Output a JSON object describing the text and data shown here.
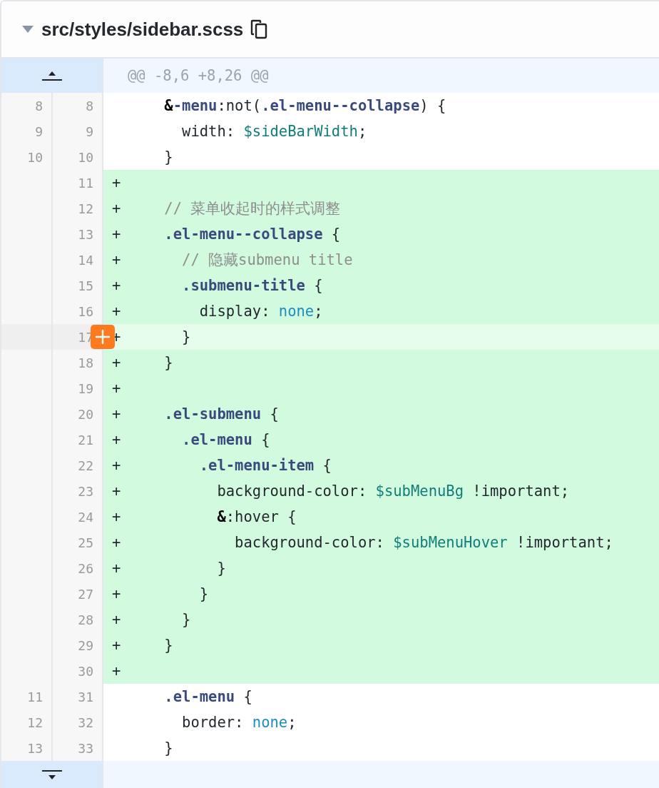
{
  "file_header": {
    "path": "src/styles/sidebar.scss",
    "expanded": true
  },
  "hunk": {
    "text": "@@ -8,6 +8,26 @@"
  },
  "lines": [
    {
      "old": "8",
      "new": "8",
      "kind": "context",
      "hovered": false,
      "tokens": [
        {
          "kind": "amp",
          "text": "    &"
        },
        {
          "kind": "selector",
          "text": "-menu"
        },
        {
          "kind": "plain",
          "text": ":not("
        },
        {
          "kind": "selector",
          "text": ".el-menu--collapse"
        },
        {
          "kind": "plain",
          "text": ") {"
        }
      ]
    },
    {
      "old": "9",
      "new": "9",
      "kind": "context",
      "hovered": false,
      "tokens": [
        {
          "kind": "plain",
          "text": "      width: "
        },
        {
          "kind": "variable",
          "text": "$sideBarWidth"
        },
        {
          "kind": "plain",
          "text": ";"
        }
      ]
    },
    {
      "old": "10",
      "new": "10",
      "kind": "context",
      "hovered": false,
      "tokens": [
        {
          "kind": "plain",
          "text": "    }"
        }
      ]
    },
    {
      "new": "11",
      "kind": "added",
      "marker": "+",
      "hovered": false
    },
    {
      "new": "12",
      "kind": "added",
      "marker": "+",
      "hovered": false,
      "tokens": [
        {
          "kind": "comment",
          "text": "    // 菜单收起时的样式调整"
        }
      ]
    },
    {
      "new": "13",
      "kind": "added",
      "marker": "+",
      "hovered": false,
      "tokens": [
        {
          "kind": "selector",
          "text": "    .el-menu--collapse"
        },
        {
          "kind": "plain",
          "text": " {"
        }
      ]
    },
    {
      "new": "14",
      "kind": "added",
      "marker": "+",
      "hovered": false,
      "tokens": [
        {
          "kind": "comment",
          "text": "      // 隐藏submenu title"
        }
      ]
    },
    {
      "new": "15",
      "kind": "added",
      "marker": "+",
      "hovered": false,
      "tokens": [
        {
          "kind": "selector",
          "text": "      .submenu-title"
        },
        {
          "kind": "plain",
          "text": " {"
        }
      ]
    },
    {
      "new": "16",
      "kind": "added",
      "marker": "+",
      "hovered": false,
      "tokens": [
        {
          "kind": "plain",
          "text": "        display: "
        },
        {
          "kind": "keyword",
          "text": "none"
        },
        {
          "kind": "plain",
          "text": ";"
        }
      ]
    },
    {
      "new": "17",
      "kind": "added",
      "marker": "+",
      "hovered": true,
      "tokens": [
        {
          "kind": "plain",
          "text": "      }"
        }
      ]
    },
    {
      "new": "18",
      "kind": "added",
      "marker": "+",
      "hovered": false,
      "tokens": [
        {
          "kind": "plain",
          "text": "    }"
        }
      ]
    },
    {
      "new": "19",
      "kind": "added",
      "marker": "+",
      "hovered": false
    },
    {
      "new": "20",
      "kind": "added",
      "marker": "+",
      "hovered": false,
      "tokens": [
        {
          "kind": "selector",
          "text": "    .el-submenu"
        },
        {
          "kind": "plain",
          "text": " {"
        }
      ]
    },
    {
      "new": "21",
      "kind": "added",
      "marker": "+",
      "hovered": false,
      "tokens": [
        {
          "kind": "selector",
          "text": "      .el-menu"
        },
        {
          "kind": "plain",
          "text": " {"
        }
      ]
    },
    {
      "new": "22",
      "kind": "added",
      "marker": "+",
      "hovered": false,
      "tokens": [
        {
          "kind": "selector",
          "text": "        .el-menu-item"
        },
        {
          "kind": "plain",
          "text": " {"
        }
      ]
    },
    {
      "new": "23",
      "kind": "added",
      "marker": "+",
      "hovered": false,
      "tokens": [
        {
          "kind": "plain",
          "text": "          background-color: "
        },
        {
          "kind": "variable",
          "text": "$subMenuBg"
        },
        {
          "kind": "plain",
          "text": " !important;"
        }
      ]
    },
    {
      "new": "24",
      "kind": "added",
      "marker": "+",
      "hovered": false,
      "tokens": [
        {
          "kind": "amp",
          "text": "          &"
        },
        {
          "kind": "plain",
          "text": ":hover {"
        }
      ]
    },
    {
      "new": "25",
      "kind": "added",
      "marker": "+",
      "hovered": false,
      "tokens": [
        {
          "kind": "plain",
          "text": "            background-color: "
        },
        {
          "kind": "variable",
          "text": "$subMenuHover"
        },
        {
          "kind": "plain",
          "text": " !important;"
        }
      ]
    },
    {
      "new": "26",
      "kind": "added",
      "marker": "+",
      "hovered": false,
      "tokens": [
        {
          "kind": "plain",
          "text": "          }"
        }
      ]
    },
    {
      "new": "27",
      "kind": "added",
      "marker": "+",
      "hovered": false,
      "tokens": [
        {
          "kind": "plain",
          "text": "        }"
        }
      ]
    },
    {
      "new": "28",
      "kind": "added",
      "marker": "+",
      "hovered": false,
      "tokens": [
        {
          "kind": "plain",
          "text": "      }"
        }
      ]
    },
    {
      "new": "29",
      "kind": "added",
      "marker": "+",
      "hovered": false,
      "tokens": [
        {
          "kind": "plain",
          "text": "    }"
        }
      ]
    },
    {
      "new": "30",
      "kind": "added",
      "marker": "+",
      "hovered": false
    },
    {
      "old": "11",
      "new": "31",
      "kind": "context",
      "hovered": false,
      "tokens": [
        {
          "kind": "selector",
          "text": "    .el-menu"
        },
        {
          "kind": "plain",
          "text": " {"
        }
      ]
    },
    {
      "old": "12",
      "new": "32",
      "kind": "context",
      "hovered": false,
      "tokens": [
        {
          "kind": "plain",
          "text": "      border: "
        },
        {
          "kind": "keyword",
          "text": "none"
        },
        {
          "kind": "plain",
          "text": ";"
        }
      ]
    },
    {
      "old": "13",
      "new": "33",
      "kind": "context",
      "hovered": false,
      "tokens": [
        {
          "kind": "plain",
          "text": "    }"
        }
      ]
    }
  ]
}
